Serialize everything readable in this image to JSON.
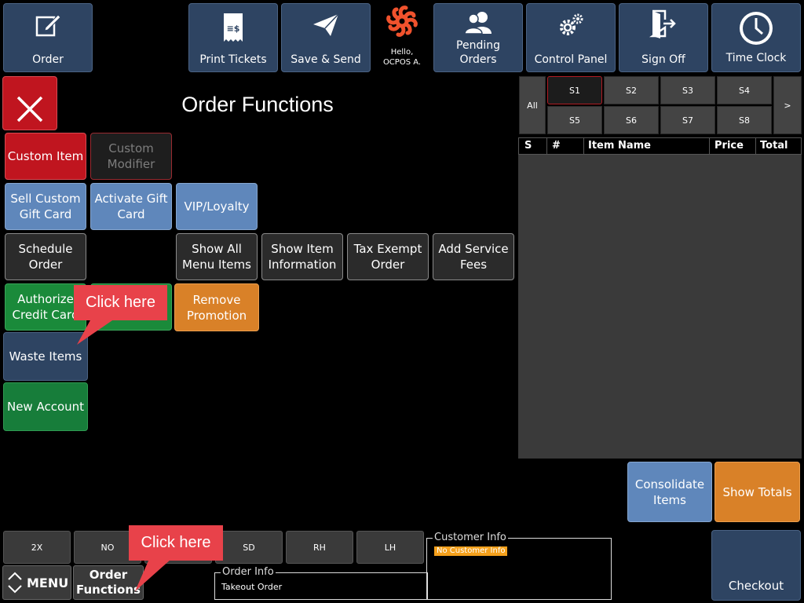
{
  "top_bar": {
    "order_label": "Order",
    "print_tickets_label": "Print Tickets",
    "save_send_label": "Save & Send",
    "greeting": "Hello,",
    "user_name": "OCPOS A.",
    "pending_orders_label": "Pending\nOrders",
    "control_panel_label": "Control Panel",
    "sign_off_label": "Sign Off",
    "time_clock_label": "Time Clock"
  },
  "panel": {
    "title": "Order Functions"
  },
  "functions": {
    "custom_item": "Custom Item",
    "custom_modifier": "Custom\nModifier",
    "sell_custom_gift_card": "Sell Custom\nGift Card",
    "activate_gift_card": "Activate Gift\nCard",
    "vip_loyalty": "VIP/Loyalty",
    "schedule_order": "Schedule\nOrder",
    "show_all_menu_items": "Show All\nMenu Items",
    "show_item_information": "Show Item\nInformation",
    "tax_exempt_order": "Tax Exempt\nOrder",
    "add_service_fees": "Add Service\nFees",
    "authorize_credit_card": "Authorize\nCredit Card",
    "remove_promotion": "Remove\nPromotion",
    "waste_items": "Waste Items",
    "new_account": "New Account"
  },
  "seats": {
    "all_label": "All",
    "items": [
      "S1",
      "S2",
      "S3",
      "S4",
      "S5",
      "S6",
      "S7",
      "S8"
    ],
    "next_label": ">"
  },
  "order_table": {
    "columns": [
      "S",
      "#",
      "Item Name",
      "Price",
      "Total"
    ],
    "rows": []
  },
  "right_actions": {
    "consolidate_items": "Consolidate\nItems",
    "show_totals": "Show Totals",
    "checkout": "Checkout"
  },
  "modifiers": [
    "2X",
    "NO",
    "",
    "SD",
    "RH",
    "LH"
  ],
  "bottom": {
    "menu_label": "MENU",
    "order_functions_label": "Order\nFunctions"
  },
  "customer_info": {
    "legend": "Customer Info",
    "value": "No Customer Info"
  },
  "order_info": {
    "legend": "Order Info",
    "value": "Takeout Order"
  },
  "callouts": {
    "top_callout": "Click here",
    "bottom_callout": "Click here"
  },
  "colors": {
    "navy": "#2e4462",
    "red": "#c0151f",
    "blue": "#5f87bb",
    "green": "#1a8a3a",
    "orange": "#d98128",
    "callout": "#e8424a",
    "badge": "#f5a11c",
    "logo": "#f0522d"
  },
  "icons": {
    "order": "edit-icon",
    "print_tickets": "receipt-icon",
    "save_send": "paper-plane-icon",
    "logo": "ocpos-logo",
    "pending_orders": "users-icon",
    "control_panel": "gears-icon",
    "sign_off": "exit-door-icon",
    "time_clock": "clock-icon",
    "close": "close-icon",
    "menu": "chevron-up-down-icon"
  }
}
